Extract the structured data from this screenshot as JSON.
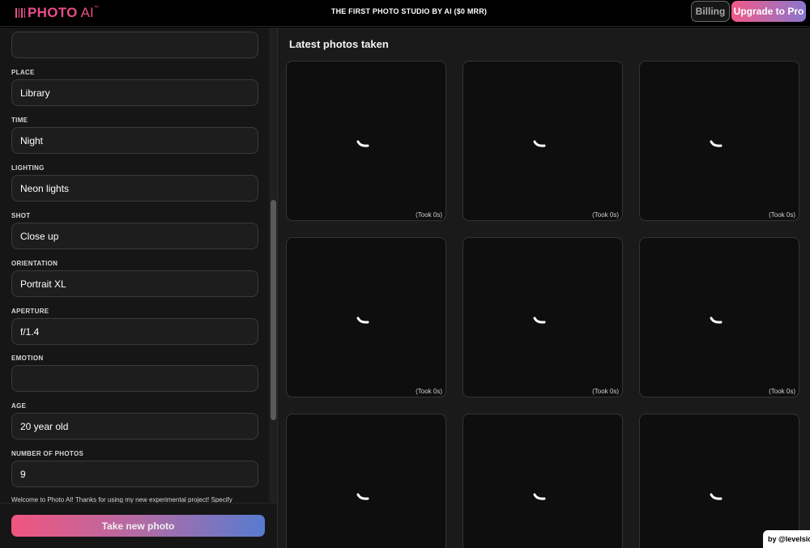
{
  "header": {
    "logo_text": "PHOTO",
    "logo_ai": "AI",
    "logo_tm": "™",
    "tagline": "THE FIRST PHOTO STUDIO BY AI ($0 MRR)",
    "billing_label": "Billing",
    "upgrade_label": "Upgrade to Pro"
  },
  "form": {
    "fields": [
      {
        "label": "PLACE",
        "value": "Library"
      },
      {
        "label": "TIME",
        "value": "Night"
      },
      {
        "label": "LIGHTING",
        "value": "Neon lights"
      },
      {
        "label": "SHOT",
        "value": "Close up"
      },
      {
        "label": "ORIENTATION",
        "value": "Portrait XL"
      },
      {
        "label": "APERTURE",
        "value": "f/1.4"
      },
      {
        "label": "EMOTION",
        "value": ""
      },
      {
        "label": "AGE",
        "value": "20 year old"
      },
      {
        "label": "NUMBER OF PHOTOS",
        "value": "9"
      }
    ],
    "welcome_text": "Welcome to Photo AI! Thanks for using my new experimental project! Specify",
    "take_photo_label": "Take new photo"
  },
  "gallery": {
    "title": "Latest photos taken",
    "tiles": [
      {
        "took": "(Took 0s)"
      },
      {
        "took": "(Took 0s)"
      },
      {
        "took": "(Took 0s)"
      },
      {
        "took": "(Took 0s)"
      },
      {
        "took": "(Took 0s)"
      },
      {
        "took": "(Took 0s)"
      },
      {
        "took": ""
      },
      {
        "took": ""
      },
      {
        "took": ""
      }
    ]
  },
  "footer": {
    "by_label": "by @levelsio"
  },
  "colors": {
    "accent_pink": "#f0557e",
    "accent_blue": "#577bd0"
  }
}
